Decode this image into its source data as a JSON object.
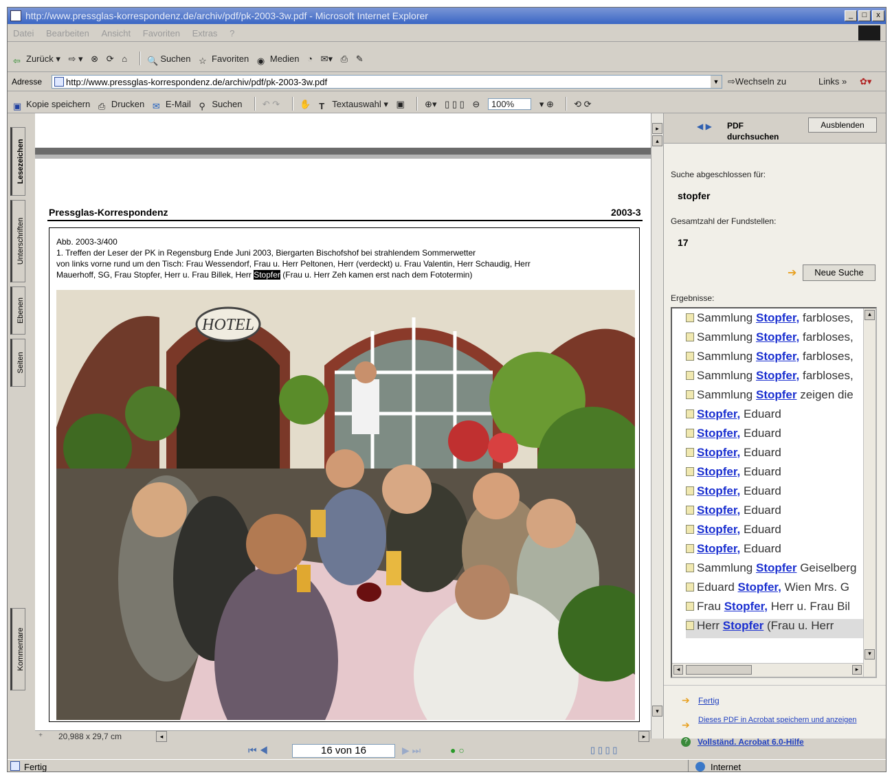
{
  "window": {
    "title": "http://www.pressglas-korrespondenz.de/archiv/pdf/pk-2003-3w.pdf - Microsoft Internet Explorer",
    "controls": [
      "_",
      "□",
      "x"
    ]
  },
  "menu": [
    "Datei",
    "Bearbeiten",
    "Ansicht",
    "Favoriten",
    "Extras",
    "?"
  ],
  "nav_toolbar": {
    "back": "Zurück",
    "search": "Suchen",
    "favorites": "Favoriten",
    "media": "Medien"
  },
  "address_bar": {
    "label": "Adresse",
    "url": "http://www.pressglas-korrespondenz.de/archiv/pdf/pk-2003-3w.pdf",
    "go": "Wechseln zu",
    "links": "Links"
  },
  "pdf_toolbar": {
    "save_copy": "Kopie speichern",
    "print": "Drucken",
    "email": "E-Mail",
    "search": "Suchen",
    "text_select": "Textauswahl",
    "zoom": "100%"
  },
  "side_tabs": [
    "Lesezeichen",
    "Unterschriften",
    "Ebenen",
    "Seiten",
    "Kommentare"
  ],
  "document": {
    "header_left": "Pressglas-Korrespondenz",
    "header_right": "2003-3",
    "caption_id": "Abb. 2003-3/400",
    "caption_line1": "1. Treffen der Leser der PK in Regensburg Ende Juni 2003, Biergarten Bischofshof bei strahlendem Sommerwetter",
    "caption_line2": "von links vorne rund um den Tisch: Frau Wessendorf, Frau u. Herr Peltonen, Herr (verdeckt) u. Frau Valentin, Herr Schaudig, Herr",
    "caption_line3_pre": "Mauerhoff, SG, Frau Stopfer, Herr u. Frau Billek, Herr ",
    "caption_highlight": "Stopfer",
    "caption_line3_post": " (Frau u. Herr Zeh kamen erst nach dem Fototermin)",
    "photo_sign": "HOTEL"
  },
  "page_bar": {
    "page_size": "20,988 x 29,7 cm",
    "page_counter": "16 von 16"
  },
  "search_panel": {
    "title_line1": "PDF",
    "title_line2": "durchsuchen",
    "hide_button": "Ausblenden",
    "finished_label": "Suche abgeschlossen für:",
    "query": "stopfer",
    "total_label": "Gesamtzahl der Fundstellen:",
    "total": "17",
    "new_search": "Neue Suche",
    "results_label": "Ergebnisse:",
    "results": [
      {
        "pre": "Sammlung ",
        "hit": "Stopfer,",
        "post": " farbloses,"
      },
      {
        "pre": "Sammlung ",
        "hit": "Stopfer,",
        "post": " farbloses,"
      },
      {
        "pre": "Sammlung ",
        "hit": "Stopfer,",
        "post": " farbloses,"
      },
      {
        "pre": "Sammlung ",
        "hit": "Stopfer,",
        "post": " farbloses,"
      },
      {
        "pre": "Sammlung ",
        "hit": "Stopfer",
        "post": " zeigen die"
      },
      {
        "pre": "",
        "hit": "Stopfer,",
        "post": " Eduard"
      },
      {
        "pre": "",
        "hit": "Stopfer,",
        "post": " Eduard"
      },
      {
        "pre": "",
        "hit": "Stopfer,",
        "post": " Eduard"
      },
      {
        "pre": "",
        "hit": "Stopfer,",
        "post": " Eduard"
      },
      {
        "pre": "",
        "hit": "Stopfer,",
        "post": " Eduard"
      },
      {
        "pre": "",
        "hit": "Stopfer,",
        "post": " Eduard"
      },
      {
        "pre": "",
        "hit": "Stopfer,",
        "post": " Eduard"
      },
      {
        "pre": "",
        "hit": "Stopfer,",
        "post": " Eduard"
      },
      {
        "pre": "Sammlung ",
        "hit": "Stopfer",
        "post": " Geiselberg"
      },
      {
        "pre": "Eduard ",
        "hit": "Stopfer,",
        "post": " Wien Mrs. G"
      },
      {
        "pre": "Frau ",
        "hit": "Stopfer,",
        "post": " Herr u. Frau Bil"
      },
      {
        "pre": "Herr ",
        "hit": "Stopfer",
        "post": " (Frau u. Herr"
      }
    ],
    "link_done": "Fertig",
    "link_save": "Dieses PDF in Acrobat speichern und anzeigen",
    "link_help": "Vollständ. Acrobat 6.0-Hilfe"
  },
  "status_bar": {
    "left": "Fertig",
    "zone": "Internet"
  }
}
